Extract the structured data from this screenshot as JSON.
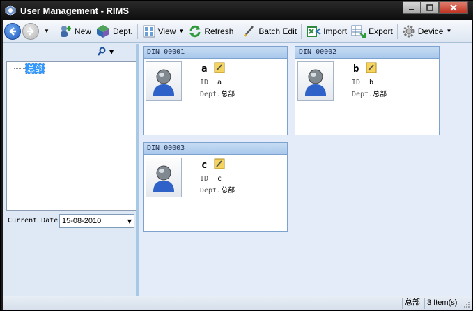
{
  "window": {
    "title": "User Management - RIMS"
  },
  "toolbar": {
    "new": "New",
    "dept": "Dept.",
    "view": "View",
    "refresh": "Refresh",
    "batch_edit": "Batch Edit",
    "import": "Import",
    "export": "Export",
    "device": "Device"
  },
  "tree": {
    "root": "总部"
  },
  "date": {
    "label": "Current Date",
    "value": "15-08-2010"
  },
  "cards": [
    {
      "din": "DIN 00001",
      "name": "a",
      "id_label": "ID",
      "id": "a",
      "dept_label": "Dept.",
      "dept": "总部"
    },
    {
      "din": "DIN 00002",
      "name": "b",
      "id_label": "ID",
      "id": "b",
      "dept_label": "Dept.",
      "dept": "总部"
    },
    {
      "din": "DIN 00003",
      "name": "c",
      "id_label": "ID",
      "id": "c",
      "dept_label": "Dept.",
      "dept": "总部"
    }
  ],
  "status": {
    "dept": "总部",
    "count": "3 Item(s)"
  }
}
